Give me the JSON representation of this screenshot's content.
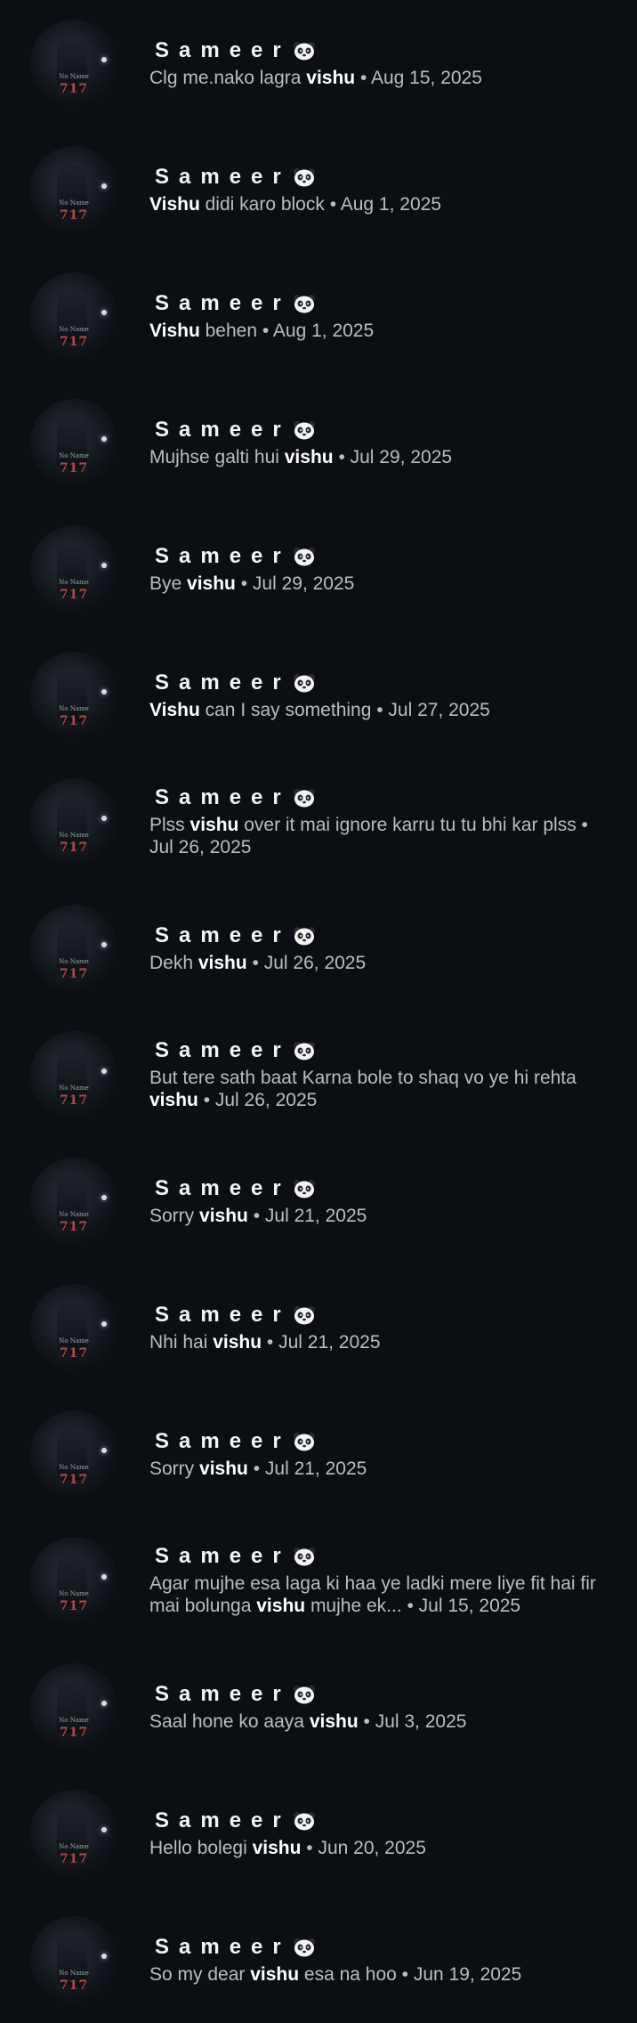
{
  "contact": {
    "name": "Sameer",
    "emoji": "panda-face",
    "avatar_caption": "No Name",
    "avatar_number": "717"
  },
  "results": [
    {
      "before": "Clg me.nako lagra ",
      "highlight": "vishu",
      "after": " • Aug 15, 2025"
    },
    {
      "before": "",
      "highlight": "Vishu",
      "after": " didi karo block • Aug 1, 2025"
    },
    {
      "before": "",
      "highlight": "Vishu",
      "after": " behen • Aug 1, 2025"
    },
    {
      "before": "Mujhse galti hui ",
      "highlight": "vishu",
      "after": " • Jul 29, 2025"
    },
    {
      "before": "Bye ",
      "highlight": "vishu",
      "after": " • Jul 29, 2025"
    },
    {
      "before": "",
      "highlight": "Vishu",
      "after": " can I say something • Jul 27, 2025"
    },
    {
      "before": "Plss ",
      "highlight": "vishu",
      "after": " over it mai ignore karru tu tu bhi kar plss • Jul 26, 2025"
    },
    {
      "before": "Dekh ",
      "highlight": "vishu",
      "after": " • Jul 26, 2025"
    },
    {
      "before": "But tere sath baat Karna bole to shaq vo ye hi rehta ",
      "highlight": "vishu",
      "after": " • Jul 26, 2025"
    },
    {
      "before": "Sorry ",
      "highlight": "vishu",
      "after": " • Jul 21, 2025"
    },
    {
      "before": "Nhi hai ",
      "highlight": "vishu",
      "after": " • Jul 21, 2025"
    },
    {
      "before": "Sorry ",
      "highlight": "vishu",
      "after": " • Jul 21, 2025"
    },
    {
      "before": "Agar mujhe esa laga ki haa ye ladki mere liye fit hai fir mai bolunga ",
      "highlight": "vishu",
      "after": " mujhe ek... • Jul 15, 2025"
    },
    {
      "before": "Saal hone ko aaya ",
      "highlight": "vishu",
      "after": " • Jul 3, 2025"
    },
    {
      "before": "Hello bolegi ",
      "highlight": "vishu",
      "after": " • Jun 20, 2025"
    },
    {
      "before": "So my dear ",
      "highlight": "vishu",
      "after": " esa na hoo • Jun 19, 2025"
    }
  ]
}
